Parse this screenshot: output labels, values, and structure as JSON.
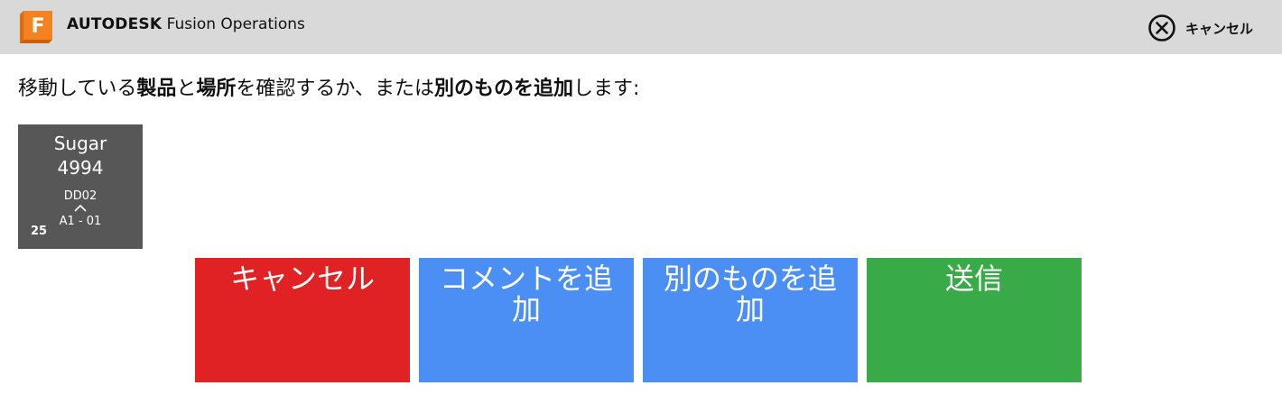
{
  "header": {
    "brand_strong": "AUTODESK",
    "brand_rest": " Fusion Operations",
    "cancel_label": "キャンセル",
    "icons": {
      "logo": "fusion-logo-icon",
      "cancel": "close-circle-icon"
    },
    "colors": {
      "background": "#d9d9d9",
      "logo_orange": "#f58220"
    }
  },
  "instruction": {
    "part1": "移動している",
    "bold1": "製品",
    "part2": "と",
    "bold2": "場所",
    "part3": "を確認するか、または",
    "bold3": "別のものを追加",
    "part4": "します:"
  },
  "item_tile": {
    "name": "Sugar",
    "code": "4994",
    "from_location": "DD02",
    "to_location": "A1 - 01",
    "quantity": "25",
    "arrow_icon": "chevron-up-icon",
    "color": "#575757"
  },
  "actions": {
    "cancel": {
      "label": "キャンセル",
      "color": "#e02225"
    },
    "add_comment": {
      "label": "コメントを追加",
      "color": "#4b8ef4"
    },
    "add_another": {
      "label": "別のものを追加",
      "color": "#4b8ef4"
    },
    "submit": {
      "label": "送信",
      "color": "#38aa48"
    }
  }
}
